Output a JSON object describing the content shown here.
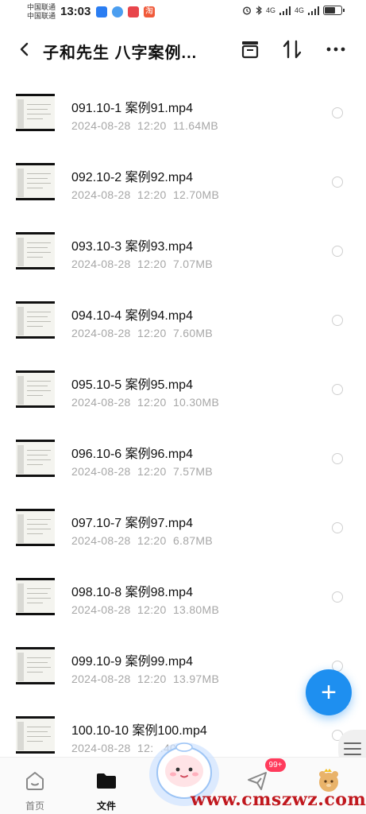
{
  "status_bar": {
    "carrier_1": "中国联通",
    "carrier_2": "中国联通",
    "time": "13:03",
    "taobao_icon_text": "淘",
    "network_1": "4G",
    "network_2": "4G",
    "battery_level": 0.7
  },
  "header": {
    "title": "子和先生  八字案例..."
  },
  "files": [
    {
      "name": "091.10-1 案例91.mp4",
      "date": "2024-08-28",
      "time": "12:20",
      "size": "11.64MB"
    },
    {
      "name": "092.10-2 案例92.mp4",
      "date": "2024-08-28",
      "time": "12:20",
      "size": "12.70MB"
    },
    {
      "name": "093.10-3 案例93.mp4",
      "date": "2024-08-28",
      "time": "12:20",
      "size": "7.07MB"
    },
    {
      "name": "094.10-4 案例94.mp4",
      "date": "2024-08-28",
      "time": "12:20",
      "size": "7.60MB"
    },
    {
      "name": "095.10-5 案例95.mp4",
      "date": "2024-08-28",
      "time": "12:20",
      "size": "10.30MB"
    },
    {
      "name": "096.10-6 案例96.mp4",
      "date": "2024-08-28",
      "time": "12:20",
      "size": "7.57MB"
    },
    {
      "name": "097.10-7 案例97.mp4",
      "date": "2024-08-28",
      "time": "12:20",
      "size": "6.87MB"
    },
    {
      "name": "098.10-8 案例98.mp4",
      "date": "2024-08-28",
      "time": "12:20",
      "size": "13.80MB"
    },
    {
      "name": "099.10-9 案例99.mp4",
      "date": "2024-08-28",
      "time": "12:20",
      "size": "13.97MB"
    },
    {
      "name": "100.10-10 案例100.mp4",
      "date": "2024-08-28",
      "time": "12:",
      "size": ".40MB"
    }
  ],
  "fab": {
    "label": "+"
  },
  "bottom_nav": {
    "home_label": "首页",
    "files_label": "文件",
    "share_badge": "99+"
  },
  "watermark": "www.cmszwz.com",
  "colors": {
    "accent": "#1e8ff0",
    "badge": "#ff3b5c",
    "meta_text": "#a7a7a7",
    "watermark": "#c0181e"
  }
}
